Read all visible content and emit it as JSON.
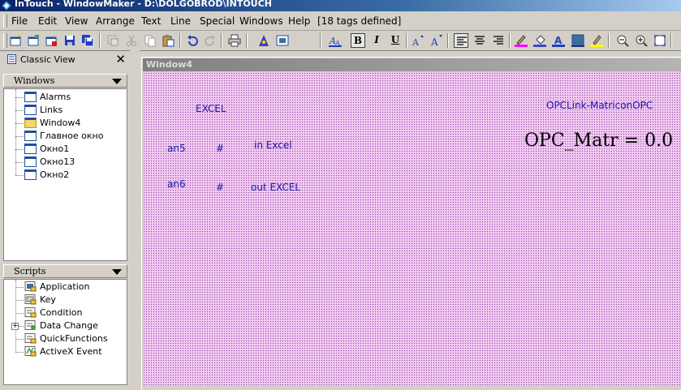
{
  "titlebar": {
    "title": "InTouch - WindowMaker - D:\\DOLGOBROD\\INTOUCH"
  },
  "menu": {
    "items": [
      {
        "label": "File"
      },
      {
        "label": "Edit"
      },
      {
        "label": "View"
      },
      {
        "label": "Arrange"
      },
      {
        "label": "Text"
      },
      {
        "label": "Line"
      },
      {
        "label": "Special"
      },
      {
        "label": "Windows"
      },
      {
        "label": "Help"
      }
    ],
    "tag_count": "[18 tags defined]"
  },
  "toolbar": {
    "buttons": [
      {
        "icon": "new-window-icon"
      },
      {
        "icon": "open-window-icon"
      },
      {
        "icon": "close-window-icon"
      },
      {
        "icon": "save-icon"
      },
      {
        "icon": "save-all-icon"
      },
      {
        "icon": "select-icon"
      },
      {
        "icon": "cut-icon"
      },
      {
        "icon": "copy-icon"
      },
      {
        "icon": "paste-icon"
      },
      {
        "icon": "undo-icon"
      },
      {
        "icon": "redo-icon"
      },
      {
        "icon": "print-icon"
      },
      {
        "icon": "wizard-icon"
      },
      {
        "icon": "tagname-dictionary-icon"
      },
      {
        "icon": "font-icon"
      },
      {
        "icon": "bold-icon",
        "text": "B",
        "pressed": true
      },
      {
        "icon": "italic-icon",
        "text": "I"
      },
      {
        "icon": "underline-icon",
        "text": "U"
      },
      {
        "icon": "font-larger-icon"
      },
      {
        "icon": "font-smaller-icon"
      },
      {
        "icon": "align-left-icon",
        "pressed": true
      },
      {
        "icon": "align-center-icon"
      },
      {
        "icon": "align-right-icon"
      },
      {
        "icon": "line-color-icon"
      },
      {
        "icon": "fill-color-icon"
      },
      {
        "icon": "text-color-icon"
      },
      {
        "icon": "window-color-icon"
      },
      {
        "icon": "highlight-icon"
      },
      {
        "icon": "zoom-out-icon"
      },
      {
        "icon": "zoom-in-icon"
      },
      {
        "icon": "zoom-fit-icon"
      }
    ],
    "colors": {
      "line": "#ff00ff",
      "fill": "#3f48cc",
      "text": "#1f3fbf",
      "window": "#3a6ea5",
      "highlight": "#ffff00"
    }
  },
  "classic_view": {
    "label": "Classic View",
    "close": "✕"
  },
  "windows_panel": {
    "header": "Windows",
    "items": [
      {
        "label": "Alarms",
        "open": false
      },
      {
        "label": "Links",
        "open": false
      },
      {
        "label": "Window4",
        "open": true
      },
      {
        "label": "Главное окно",
        "open": false
      },
      {
        "label": "Окно1",
        "open": false
      },
      {
        "label": "Окно13",
        "open": false
      },
      {
        "label": "Окно2",
        "open": false
      }
    ]
  },
  "scripts_panel": {
    "header": "Scripts",
    "items": [
      {
        "label": "Application",
        "icon": "application-script-icon"
      },
      {
        "label": "Key",
        "icon": "key-script-icon"
      },
      {
        "label": "Condition",
        "icon": "condition-script-icon"
      },
      {
        "label": "Data Change",
        "icon": "data-change-script-icon",
        "expander": "+"
      },
      {
        "label": "QuickFunctions",
        "icon": "quickfunctions-script-icon"
      },
      {
        "label": "ActiveX Event",
        "icon": "activex-event-script-icon"
      }
    ]
  },
  "window4": {
    "title": "Window4",
    "canvas_color": "#f3c8f3",
    "objects": [
      {
        "text": "EXCEL"
      },
      {
        "text": "OPCLink-MatriconOPC"
      },
      {
        "text": "an5"
      },
      {
        "text": "#"
      },
      {
        "text": "in Excel"
      },
      {
        "text": "OPC_Matr = 0.0"
      },
      {
        "text": "an6"
      },
      {
        "text": "#"
      },
      {
        "text": "out EXCEL"
      }
    ]
  }
}
